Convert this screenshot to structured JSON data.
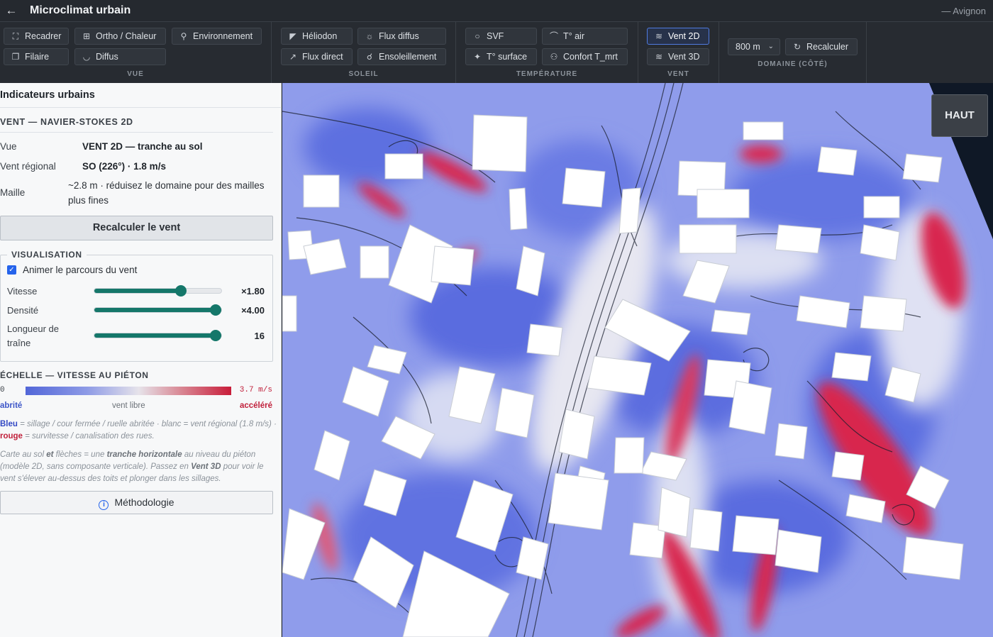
{
  "app": {
    "title": "Microclimat urbain",
    "city": "— Avignon"
  },
  "toolbar": {
    "vue": {
      "label": "VUE",
      "recadrer": "Recadrer",
      "ortho": "Ortho / Chaleur",
      "environnement": "Environnement",
      "filaire": "Filaire",
      "diffus": "Diffus"
    },
    "soleil": {
      "label": "SOLEIL",
      "heliodon": "Héliodon",
      "flux_diffus": "Flux diffus",
      "flux_direct": "Flux direct",
      "ensoleillement": "Ensoleillement"
    },
    "temperature": {
      "label": "TEMPÉRATURE",
      "svf": "SVF",
      "t_air": "T° air",
      "t_surface": "T° surface",
      "confort": "Confort T_mrt"
    },
    "vent": {
      "label": "VENT",
      "vent2d": "Vent 2D",
      "vent3d": "Vent 3D",
      "active": "Vent 2D"
    },
    "domaine": {
      "label": "DOMAINE (CÔTÉ)",
      "size": "800 m",
      "recalculer": "Recalculer"
    }
  },
  "panel": {
    "title": "Indicateurs urbains",
    "section": "VENT — NAVIER-STOKES 2D",
    "rows": [
      {
        "label": "Vue",
        "value": "VENT 2D — tranche au sol"
      },
      {
        "label": "Vent régional",
        "value": "SO (226°) · 1.8 m/s"
      },
      {
        "label": "Maille",
        "value": "~2.8 m · réduisez le domaine pour des mailles plus fines"
      }
    ],
    "recalc_button": "Recalculer le vent",
    "visualisation": {
      "legend": "VISUALISATION",
      "animate_label": "Animer le parcours du vent",
      "animate_checked": true,
      "sliders": [
        {
          "label": "Vitesse",
          "value": "×1.80",
          "fraction": 0.68
        },
        {
          "label": "Densité",
          "value": "×4.00",
          "fraction": 1.0
        },
        {
          "label": "Longueur de traîne",
          "value": "16",
          "fraction": 1.0
        }
      ]
    },
    "scale": {
      "title": "ÉCHELLE — VITESSE AU PIÉTON",
      "min": "0",
      "max": "3.7 m/s",
      "left": "abrité",
      "mid": "vent libre",
      "right": "accéléré"
    },
    "note1": {
      "bleu": "Bleu",
      "t1": " = sillage / cour fermée / ruelle abritée · blanc = vent régional (1.8 m/s) · ",
      "rouge": "rouge",
      "t2": " = survitesse / canalisation des rues."
    },
    "note2": {
      "t1": "Carte au sol ",
      "et": "et",
      "t2": " flèches = une ",
      "tranche": "tranche horizontale",
      "t3": " au niveau du piéton (modèle 2D, sans composante verticale). Passez en ",
      "v3d": "Vent 3D",
      "t4": " pour voir le vent s'élever au-dessus des toits et plonger dans les sillages."
    },
    "methodologie": "Méthodologie"
  },
  "map": {
    "haut": "HAUT"
  },
  "colors": {
    "accent": "#2563eb",
    "slider": "#15776a",
    "wind_blue": "#5b6fdc",
    "wind_red": "#d7254a"
  }
}
